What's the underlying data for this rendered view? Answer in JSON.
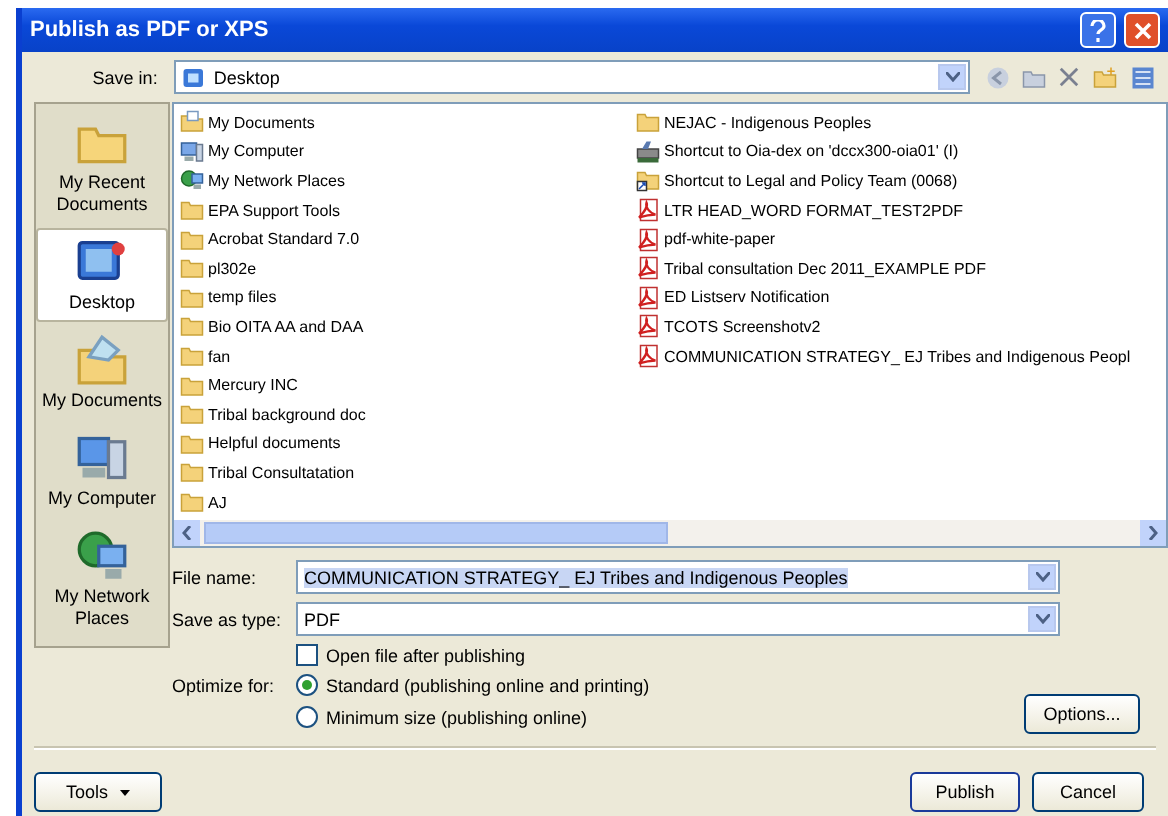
{
  "window": {
    "title": "Publish as PDF or XPS"
  },
  "save_in": {
    "label": "Save in:",
    "value": "Desktop"
  },
  "places": [
    {
      "label": "My Recent Documents",
      "kind": "recent",
      "selected": false
    },
    {
      "label": "Desktop",
      "kind": "desktop",
      "selected": true
    },
    {
      "label": "My Documents",
      "kind": "documents",
      "selected": false
    },
    {
      "label": "My Computer",
      "kind": "computer",
      "selected": false
    },
    {
      "label": "My Network Places",
      "kind": "network",
      "selected": false
    }
  ],
  "files": [
    [
      {
        "name": "My Documents",
        "kind": "documents"
      },
      {
        "name": "My Computer",
        "kind": "computer"
      },
      {
        "name": "My Network Places",
        "kind": "network"
      },
      {
        "name": "EPA Support Tools",
        "kind": "folder"
      },
      {
        "name": "Acrobat Standard 7.0",
        "kind": "folder"
      },
      {
        "name": "pl302e",
        "kind": "folder"
      },
      {
        "name": "temp files",
        "kind": "folder"
      },
      {
        "name": "Bio OITA AA and DAA",
        "kind": "folder"
      },
      {
        "name": "fan",
        "kind": "folder"
      },
      {
        "name": "Mercury INC",
        "kind": "folder"
      },
      {
        "name": "Tribal background doc",
        "kind": "folder"
      },
      {
        "name": "Helpful documents",
        "kind": "folder"
      },
      {
        "name": "Tribal Consultatation",
        "kind": "folder"
      },
      {
        "name": "AJ",
        "kind": "folder"
      }
    ],
    [
      {
        "name": "NEJAC - Indigenous Peoples",
        "kind": "folder"
      },
      {
        "name": "Shortcut to Oia-dex on 'dccx300-oia01' (I)",
        "kind": "drive"
      },
      {
        "name": "Shortcut to Legal and Policy Team (0068)",
        "kind": "shortcut"
      },
      {
        "name": "LTR HEAD_WORD FORMAT_TEST2PDF",
        "kind": "pdf"
      },
      {
        "name": "pdf-white-paper",
        "kind": "pdf"
      },
      {
        "name": "Tribal consultation Dec 2011_EXAMPLE PDF",
        "kind": "pdf"
      },
      {
        "name": "ED Listserv Notification",
        "kind": "pdf"
      },
      {
        "name": "TCOTS Screenshotv2",
        "kind": "pdf"
      },
      {
        "name": "COMMUNICATION STRATEGY_ EJ Tribes and Indigenous Peopl",
        "kind": "pdf"
      }
    ]
  ],
  "file_name": {
    "label": "File name:",
    "value": "COMMUNICATION STRATEGY_ EJ Tribes and Indigenous Peoples"
  },
  "save_as_type": {
    "label": "Save as type:",
    "value": "PDF"
  },
  "open_after": {
    "label": "Open file after publishing",
    "checked": false
  },
  "optimize": {
    "label": "Optimize for:",
    "options": [
      {
        "label": "Standard (publishing online and printing)",
        "selected": true
      },
      {
        "label": "Minimum size (publishing online)",
        "selected": false
      }
    ]
  },
  "buttons": {
    "options": "Options...",
    "tools": "Tools",
    "publish": "Publish",
    "cancel": "Cancel"
  }
}
